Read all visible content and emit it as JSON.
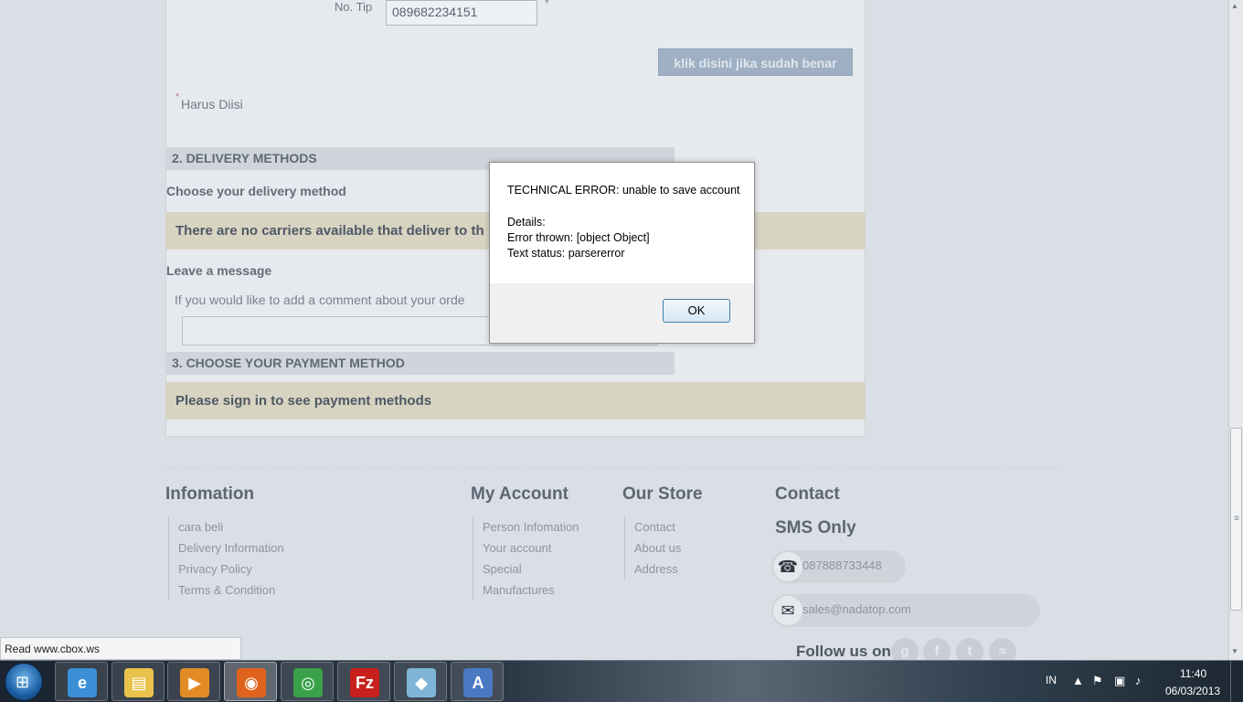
{
  "form": {
    "tip_label": "No. Tip",
    "tip_value": "089682234151",
    "confirm_button": "klik disini jika sudah benar",
    "required_star": "*",
    "required_text": "Harus Diisi"
  },
  "delivery": {
    "section_title": "2. DELIVERY METHODS",
    "choose_label": "Choose your delivery method",
    "no_carriers_text": "There are no carriers available that deliver to th",
    "leave_message_label": "Leave a message",
    "comment_prompt": "If you would like to add a comment about your orde"
  },
  "payment": {
    "section_title": "3. CHOOSE YOUR PAYMENT METHOD",
    "sign_in_text": "Please sign in to see payment methods"
  },
  "footer": {
    "information": {
      "title": "Infomation",
      "items": [
        "cara beli",
        "Delivery Information",
        "Privacy Policy",
        "Terms & Condition"
      ]
    },
    "my_account": {
      "title": "My Account",
      "items": [
        "Person Infomation",
        "Your account",
        "Special",
        "Manufactures"
      ]
    },
    "our_store": {
      "title": "Our Store",
      "items": [
        "Contact",
        "About us",
        "Address"
      ]
    },
    "contact": {
      "title": "Contact",
      "sms_only": "SMS Only",
      "phone": "087888733448",
      "email": "sales@nadatop.com",
      "follow_us": "Follow us on"
    }
  },
  "status_bar": {
    "text": "Read www.cbox.ws"
  },
  "dialog": {
    "line1": "TECHNICAL ERROR: unable to save account",
    "line2": "Details:",
    "line3": "Error thrown: [object Object]",
    "line4": "Text status: parsererror",
    "ok_label": "OK"
  },
  "taskbar": {
    "apps": [
      {
        "name": "internet-explorer",
        "glyph": "e",
        "color": "#3a8fd6"
      },
      {
        "name": "windows-explorer",
        "glyph": "▤",
        "color": "#e8c24a"
      },
      {
        "name": "media-player",
        "glyph": "▶",
        "color": "#e38b26"
      },
      {
        "name": "firefox",
        "glyph": "◉",
        "color": "#e0631d"
      },
      {
        "name": "chrome",
        "glyph": "◎",
        "color": "#3aa04a"
      },
      {
        "name": "filezilla",
        "glyph": "Fz",
        "color": "#c8201c"
      },
      {
        "name": "app-generic",
        "glyph": "◆",
        "color": "#7fb5d8"
      },
      {
        "name": "word-document",
        "glyph": "A",
        "color": "#4a79c2"
      }
    ],
    "language": "IN",
    "time": "11:40",
    "date": "06/03/2013"
  }
}
